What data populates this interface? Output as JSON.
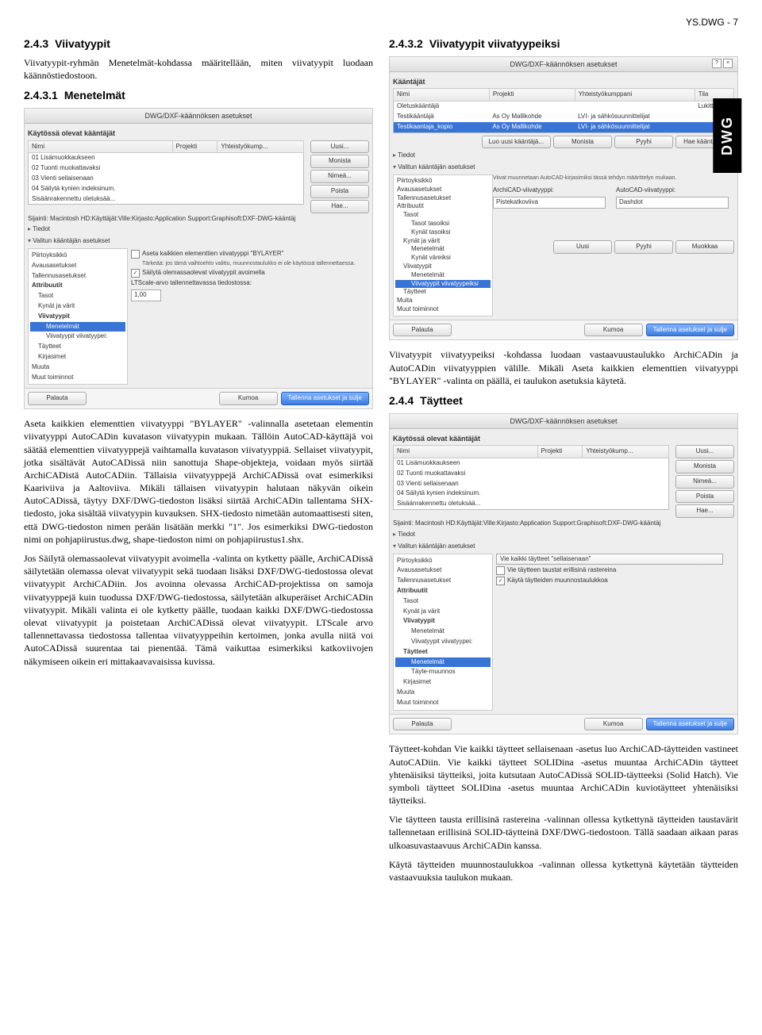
{
  "page_header": "YS.DWG - 7",
  "side_label": "DWG",
  "left": {
    "h243": {
      "num": "2.4.3",
      "title": "Viivatyypit"
    },
    "h243_intro": "Viivatyypit-ryhmän Menetelmät-kohdassa määritellään, miten viivatyypit luodaan käännöstiedostoon.",
    "h2431": {
      "num": "2.4.3.1",
      "title": "Menetelmät"
    },
    "big_para": "Aseta kaikkien elementtien viivatyyppi \"BYLAYER\" -valinnalla asetetaan elementin viivatyyppi AutoCADin kuvatason viivatyypin mukaan. Tällöin AutoCAD-käyttäjä voi säätää elementtien viivatyyppejä vaihtamalla kuvatason viivatyyppiä. Sellaiset viivatyypit, jotka sisältävät AutoCADissä niin sanottuja Shape-objekteja, voidaan myös siirtää ArchiCADistä AutoCADiin. Tällaisia viivatyyppejä ArchiCADissä ovat esimerkiksi Kaariviiva ja Aaltoviiva. Mikäli tällaisen viivatyypin halutaan näkyvän oikein AutoCADissä, täytyy DXF/DWG-tiedoston lisäksi siirtää ArchiCADin tallentama SHX-tiedosto, joka sisältää viivatyypin kuvauksen. SHX-tiedosto nimetään automaattisesti siten, että DWG-tiedoston nimen perään lisätään merkki \"1\". Jos esimerkiksi DWG-tiedoston nimi on pohjapiirustus.dwg, shape-tiedoston nimi on pohjapiirustus1.shx.",
    "para2": "Jos Säilytä olemassaolevat viivatyypit avoimella -valinta on kytketty päälle, ArchiCADissä säilytetään olemassa olevat viivatyypit sekä tuodaan lisäksi DXF/DWG-tiedostossa olevat viivatyypit ArchiCADiin. Jos avoinna olevassa ArchiCAD-projektissa on samoja viivatyyppejä kuin tuodussa DXF/DWG-tiedostossa, säilytetään alkuperäiset ArchiCADin viivatyypit. Mikäli valinta ei ole kytketty päälle, tuodaan kaikki DXF/DWG-tiedostossa olevat viivatyypit ja poistetaan ArchiCADissä olevat viivatyypit. LTScale arvo tallennettavassa tiedostossa tallentaa viivatyyppeihin kertoimen, jonka avulla niitä voi AutoCADissä suurentaa tai pienentää. Tämä vaikuttaa esimerkiksi katkoviivojen näkymiseen oikein eri mittakaavavaisissa kuvissa."
  },
  "right": {
    "h2432": {
      "num": "2.4.3.2",
      "title": "Viivatyypit viivatyypeiksi"
    },
    "para1": "Viivatyypit viivatyypeiksi -kohdassa luodaan vastaavuustaulukko ArchiCADin ja AutoCADin viivatyyppien välille. Mikäli Aseta kaikkien elementtien viivatyyppi \"BYLAYER\" -valinta on päällä, ei taulukon asetuksia käytetä.",
    "h244": {
      "num": "2.4.4",
      "title": "Täytteet"
    },
    "para2": "Täytteet-kohdan Vie kaikki täytteet sellaisenaan -asetus luo ArchiCAD-täytteiden vastineet AutoCADiin. Vie kaikki täytteet SOLIDina -asetus muuntaa ArchiCADin täytteet yhtenäisiksi täytteiksi, joita kutsutaan AutoCADissä SOLID-täytteeksi (Solid Hatch). Vie symboli täytteet SOLIDina -asetus muuntaa ArchiCADin kuviotäytteet yhtenäisiksi täytteiksi.",
    "para3": "Vie täytteen tausta erillisinä rastereina -valinnan ollessa kytkettynä täytteiden taustavärit tallennetaan erillisinä SOLID-täytteinä DXF/DWG-tiedostoon. Tällä saadaan aikaan paras ulkoasuvastaavuus ArchiCADin kanssa.",
    "para4": "Käytä täytteiden muunnostaulukkoa -valinnan ollessa kytkettynä käytetään täytteiden vastaavuuksia taulukon mukaan."
  },
  "ss1": {
    "title": "DWG/DXF-käännöksen asetukset",
    "section": "Käytössä olevat kääntäjät",
    "cols": [
      "Nimi",
      "Projekti",
      "Yhteistyökump..."
    ],
    "rows": [
      "01 Lisämuokkaukseen",
      "02 Tuonti muokattavaksi",
      "03 Vienti sellaisenaan",
      "04 Säilytä kynien indeksinum.",
      "Sisäänrakennettu oletuksää..."
    ],
    "buttons": [
      "Uusi...",
      "Monista",
      "Nimeä...",
      "Poista",
      "Hae..."
    ],
    "sijainti_label": "Sijainti:",
    "sijainti_path": "Macintosh HD:Käyttäjät:Ville:Kirjasto:Application Support:Graphisoft:DXF-DWG-kääntäj",
    "disclosures": [
      "Tiedot",
      "Valitun kääntäjän asetukset"
    ],
    "sidebar": [
      "Piirtoyksikkö",
      "Avausasetukset",
      "Tallennusasetukset",
      "Attribuutit",
      "Tasot",
      "Kynät ja värit",
      "Viivatyypit",
      "Menetelmät",
      "Viivatyypit viivatyypei:",
      "Täytteet",
      "Kirjasimet",
      "Muuta",
      "Muut toiminnot"
    ],
    "sidebar_selected_index": 7,
    "chk1": "Aseta kaikkien elementtien viivatyyppi \"BYLAYER\"",
    "chk1_hint": "Tärkeää: jos tämä vaihtoehto valittu, muunnostaulukko ei ole käytössä tallennettaessa.",
    "chk2": "Säilytä olemassaolevat viivatyypit avoimella",
    "lt_label": "LTScale-arvo tallennettavassa tiedostossa:",
    "lt_value": "1,00",
    "footer_left": "Palauta",
    "footer_right": [
      "Kumoa",
      "Tallenna asetukset ja sulje"
    ]
  },
  "ss2": {
    "title": "DWG/DXF-käännöksen asetukset",
    "section": "Kääntäjät",
    "cols": [
      "Nimi",
      "Projekti",
      "Yhteistyökumppani",
      "Tila"
    ],
    "rows": [
      {
        "name": "Oletuskääntäjä",
        "proj": "",
        "y": "",
        "tila": "Lukittu"
      },
      {
        "name": "Testikääntäjä",
        "proj": "As Oy Mallikohde",
        "y": "LVI- ja sähkösuunnittelijat",
        "tila": ""
      },
      {
        "name": "Testikaantaja_kopio",
        "proj": "As Oy Mallikohde",
        "y": "LVI- ja sähkösuunnittelijat",
        "tila": "",
        "sel": true
      }
    ],
    "btnrow": [
      "Luo uusi kääntäjä...",
      "Monista",
      "Pyyhi",
      "Hae kääntäjä..."
    ],
    "disclosures": [
      "Tiedot",
      "Valitun kääntäjän asetukset"
    ],
    "tree": [
      "Piirtoyksikkö",
      "Avausasetukset",
      "Tallennusasetukset",
      "Attribuutit",
      "Tasot",
      "Tasot tasoiksi",
      "Kynät tasoiksi",
      "Kynät ja värit",
      "Menetelmät",
      "Kynät väreiksi",
      "Viivatyypit",
      "Menetelmät",
      "Viivatyypit viivatyypeiksi",
      "Täytteet",
      "Muita",
      "Muut toiminnot"
    ],
    "tree_selected_index": 12,
    "note": "Viivat muunnetaan AutoCAD-kirjasimiksi tässä tehdyn määrittelyn mukaan.",
    "ac_lbl": "ArchiCAD-viivatyyppi:",
    "au_lbl": "AutoCAD-viivatyyppi:",
    "ac_val": "Pistekatkoviiva",
    "au_val": "Dashdot",
    "small_btns": [
      "Uusi",
      "Pyyhi",
      "Muokkaa"
    ],
    "footer_left": "Palauta",
    "footer_right": [
      "Kumoa",
      "Tallenna asetukset ja sulje"
    ]
  },
  "ss3": {
    "title": "DWG/DXF-käännöksen asetukset",
    "section": "Käytössä olevat kääntäjät",
    "cols": [
      "Nimi",
      "Projekti",
      "Yhteistyökump..."
    ],
    "rows": [
      "01 Lisämuokkaukseen",
      "02 Tuonti muokattavaksi",
      "03 Vienti sellaisenaan",
      "04 Säilytä kynien indeksinum.",
      "Sisäänrakennettu oletuksää..."
    ],
    "buttons": [
      "Uusi...",
      "Monista",
      "Nimeä...",
      "Poista",
      "Hae..."
    ],
    "sijainti_label": "Sijainti:",
    "sijainti_path": "Macintosh HD:Käyttäjät:Ville:Kirjasto:Application Support:Graphisoft:DXF-DWG-kääntäj",
    "disclosures": [
      "Tiedot",
      "Valitun kääntäjän asetukset"
    ],
    "sidebar": [
      "Piirtoyksikkö",
      "Avausasetukset",
      "Tallennusasetukset",
      "Attribuutit",
      "Tasot",
      "Kynät ja värit",
      "Viivatyypit",
      "Menetelmät",
      "Viivatyypit viivatyypei:",
      "Täytteet",
      "Menetelmät",
      "Täyte-muunnos",
      "Kirjasimet",
      "Muuta",
      "Muut toiminnot"
    ],
    "sidebar_selected_index": 10,
    "dropdown": "Vie kaikki täytteet \"sellaisenaan\"",
    "chk1": "Vie täytteen taustat erillisinä rastereina",
    "chk2": "Käytä täytteiden muunnostaulukkoa",
    "footer_left": "Palauta",
    "footer_right": [
      "Kumoa",
      "Tallenna asetukset ja sulje"
    ]
  }
}
